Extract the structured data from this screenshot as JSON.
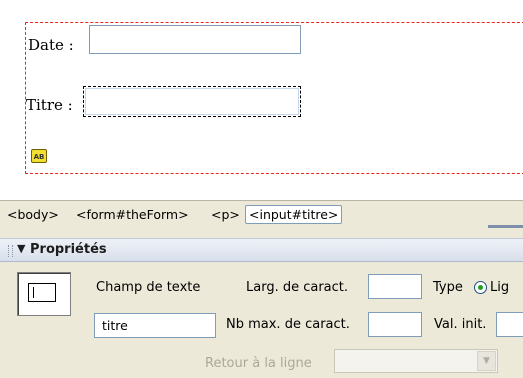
{
  "canvas": {
    "date_label": "Date :",
    "titre_label": "Titre :",
    "date_value": "",
    "titre_value": "",
    "form_icon": "form-hidden-field-icon"
  },
  "tag_selector": {
    "tags": [
      "<body>",
      "<form#theForm>",
      "<p>",
      "<input#titre>"
    ],
    "selected": "<input#titre>"
  },
  "properties_panel": {
    "title": "Propriétés",
    "collapse_icon": "triangle-down-icon",
    "element_type_label": "Champ de texte",
    "name_value": "titre",
    "char_width_label": "Larg. de caract.",
    "char_width_value": "",
    "max_chars_label": "Nb max. de caract.",
    "max_chars_value": "",
    "type_label": "Type",
    "type_selected": "Lig",
    "init_value_label": "Val. init.",
    "init_value": "",
    "wrap_label": "Retour à la ligne",
    "wrap_value": ""
  },
  "colors": {
    "form_outline": "#e8281c",
    "panel_bg": "#ece9d8",
    "input_border": "#7f9db9"
  }
}
